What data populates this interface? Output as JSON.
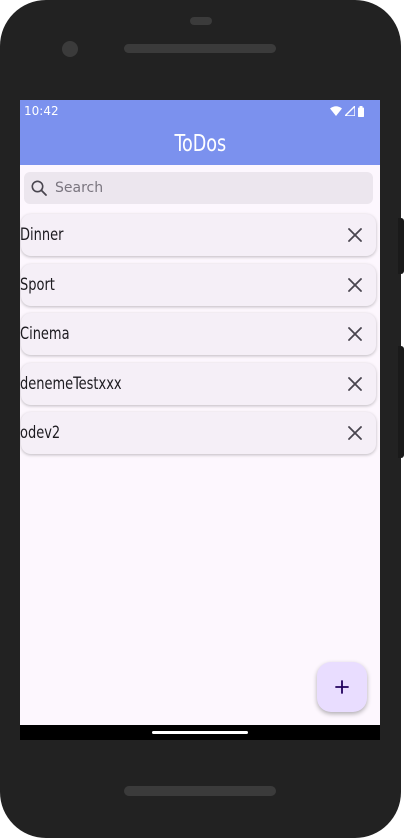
{
  "status_bar": {
    "time": "10:42",
    "icons": [
      "wifi-icon",
      "signal-icon",
      "battery-icon"
    ]
  },
  "app_bar": {
    "title": "ToDos"
  },
  "search": {
    "placeholder": "Search",
    "icon": "search-icon"
  },
  "todos": [
    {
      "label": "Dinner",
      "remove_icon": "close-icon"
    },
    {
      "label": "Sport",
      "remove_icon": "close-icon"
    },
    {
      "label": "Cinema",
      "remove_icon": "close-icon"
    },
    {
      "label": "denemeTestxxx",
      "remove_icon": "close-icon"
    },
    {
      "label": "odev2",
      "remove_icon": "close-icon"
    }
  ],
  "fab": {
    "icon": "plus-icon"
  },
  "colors": {
    "app_bar": "#7b91ee",
    "background": "#fdf7fe",
    "search_bg": "#ece6ee",
    "item_bg": "#f5eff7",
    "fab_bg": "#e9ddff"
  }
}
